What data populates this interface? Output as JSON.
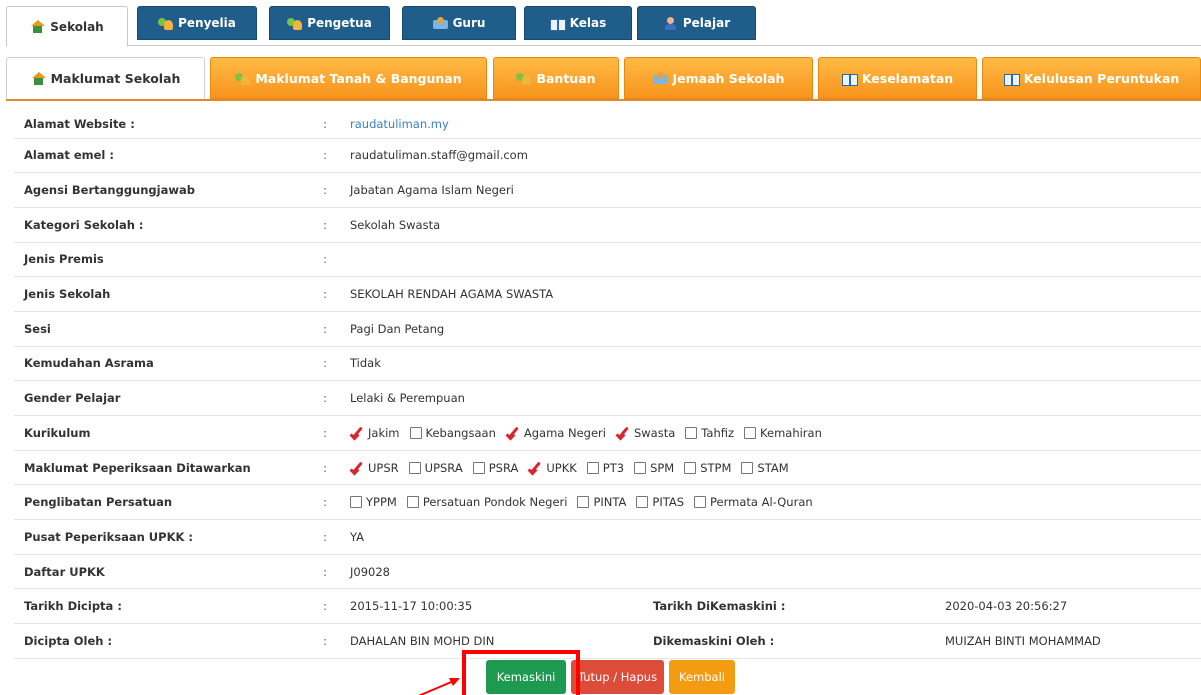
{
  "top_tabs": [
    {
      "label": "Sekolah",
      "icon": "home-icon",
      "active": true
    },
    {
      "label": "Penyelia",
      "icon": "users-icon",
      "active": false
    },
    {
      "label": "Pengetua",
      "icon": "users-icon",
      "active": false
    },
    {
      "label": "Guru",
      "icon": "teacher-icon",
      "active": false
    },
    {
      "label": "Kelas",
      "icon": "book-icon",
      "active": false
    },
    {
      "label": "Pelajar",
      "icon": "person-icon",
      "active": false
    }
  ],
  "sub_tabs": [
    {
      "label": "Maklumat Sekolah",
      "icon": "home-icon",
      "active": true
    },
    {
      "label": "Maklumat Tanah & Bangunan",
      "icon": "users-icon",
      "active": false
    },
    {
      "label": "Bantuan",
      "icon": "users-icon",
      "active": false
    },
    {
      "label": "Jemaah Sekolah",
      "icon": "teacher-icon",
      "active": false
    },
    {
      "label": "Keselamatan",
      "icon": "book-icon",
      "active": false
    },
    {
      "label": "Kelulusan Peruntukan",
      "icon": "book-icon",
      "active": false
    }
  ],
  "colon": ":",
  "rows": {
    "website": {
      "label": "Alamat Website :",
      "value": "raudatuliman.my"
    },
    "email": {
      "label": "Alamat emel :",
      "value": "raudatuliman.staff@gmail.com"
    },
    "agensi": {
      "label": "Agensi Bertanggungjawab",
      "value": "Jabatan Agama Islam Negeri"
    },
    "kategori": {
      "label": "Kategori Sekolah :",
      "value": "Sekolah Swasta"
    },
    "premis": {
      "label": "Jenis Premis",
      "value": ""
    },
    "jenis": {
      "label": "Jenis Sekolah",
      "value": "SEKOLAH RENDAH AGAMA SWASTA"
    },
    "sesi": {
      "label": "Sesi",
      "value": "Pagi Dan Petang"
    },
    "asrama": {
      "label": "Kemudahan Asrama",
      "value": "Tidak"
    },
    "gender": {
      "label": "Gender Pelajar",
      "value": "Lelaki & Perempuan"
    },
    "kurikulum": {
      "label": "Kurikulum",
      "options": [
        {
          "label": "Jakim",
          "checked": true
        },
        {
          "label": "Kebangsaan",
          "checked": false
        },
        {
          "label": "Agama Negeri",
          "checked": true
        },
        {
          "label": "Swasta",
          "checked": true
        },
        {
          "label": "Tahfiz",
          "checked": false
        },
        {
          "label": "Kemahiran",
          "checked": false
        }
      ]
    },
    "peperiksaan": {
      "label": "Maklumat Peperiksaan Ditawarkan",
      "options": [
        {
          "label": "UPSR",
          "checked": true
        },
        {
          "label": "UPSRA",
          "checked": false
        },
        {
          "label": "PSRA",
          "checked": false
        },
        {
          "label": "UPKK",
          "checked": true
        },
        {
          "label": "PT3",
          "checked": false
        },
        {
          "label": "SPM",
          "checked": false
        },
        {
          "label": "STPM",
          "checked": false
        },
        {
          "label": "STAM",
          "checked": false
        }
      ]
    },
    "persatuan": {
      "label": "Penglibatan Persatuan",
      "options": [
        {
          "label": "YPPM",
          "checked": false
        },
        {
          "label": "Persatuan Pondok Negeri",
          "checked": false
        },
        {
          "label": "PINTA",
          "checked": false
        },
        {
          "label": "PITAS",
          "checked": false
        },
        {
          "label": "Permata Al-Quran",
          "checked": false
        }
      ]
    },
    "pusat": {
      "label": "Pusat Peperiksaan UPKK :",
      "value": "YA"
    },
    "daftar": {
      "label": "Daftar UPKK",
      "value": "J09028"
    },
    "dicipta": {
      "label": "Tarikh Dicipta :",
      "value": "2015-11-17 10:00:35",
      "label2": "Tarikh DiKemaskini :",
      "value2": "2020-04-03 20:56:27"
    },
    "oleh": {
      "label": "Dicipta Oleh :",
      "value": "DAHALAN BIN MOHD DIN",
      "label2": "Dikemaskini Oleh :",
      "value2": "MUIZAH BINTI MOHAMMAD"
    }
  },
  "buttons": {
    "update": "Kemaskini",
    "delete": "Tutup / Hapus",
    "back": "Kembali"
  },
  "colors": {
    "tab_blue": "#1f5d8a",
    "tab_orange": "#f7941d",
    "green": "#1e9a50",
    "red": "#dd4b39",
    "orange": "#f39c12",
    "highlight": "#ff0000"
  }
}
